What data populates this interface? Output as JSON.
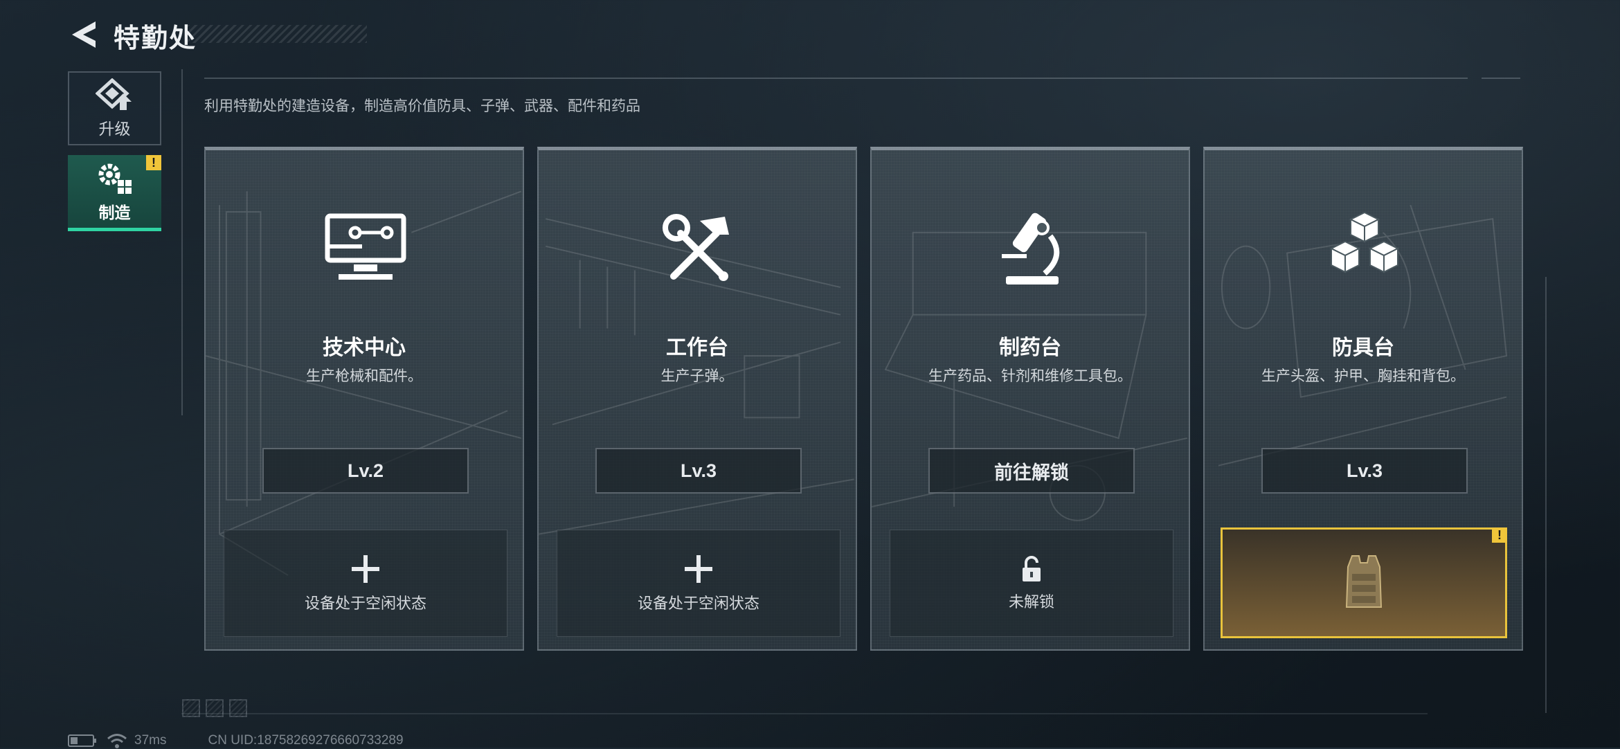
{
  "header": {
    "title": "特勤处"
  },
  "subtitle": "利用特勤处的建造设备，制造高价值防具、子弹、武器、配件和药品",
  "sidebar": {
    "tabs": [
      {
        "label": "升级",
        "icon": "upgrade-icon",
        "active": false
      },
      {
        "label": "制造",
        "icon": "gears-icon",
        "active": true,
        "badge": "!"
      }
    ]
  },
  "cards": [
    {
      "name": "技术中心",
      "desc": "生产枪械和配件。",
      "button": "Lv.2",
      "icon": "monitor-icon",
      "slot_label": "设备处于空闲状态",
      "slot_icon": "plus-icon"
    },
    {
      "name": "工作台",
      "desc": "生产子弹。",
      "button": "Lv.3",
      "icon": "hammer-wrench-icon",
      "slot_label": "设备处于空闲状态",
      "slot_icon": "plus-icon"
    },
    {
      "name": "制药台",
      "desc": "生产药品、针剂和维修工具包。",
      "button": "前往解锁",
      "icon": "microscope-icon",
      "slot_label": "未解锁",
      "slot_icon": "lock-icon"
    },
    {
      "name": "防具台",
      "desc": "生产头盔、护甲、胸挂和背包。",
      "button": "Lv.3",
      "icon": "boxes-icon",
      "slot_icon": "body-armor-icon",
      "slot_badge": "!"
    }
  ],
  "status": {
    "ping": "37ms",
    "uid": "CN UID:18758269276660733289"
  },
  "colors": {
    "accent": "#2fd3a2",
    "warning": "#f0c53a",
    "gold_border": "#e9c33c"
  }
}
